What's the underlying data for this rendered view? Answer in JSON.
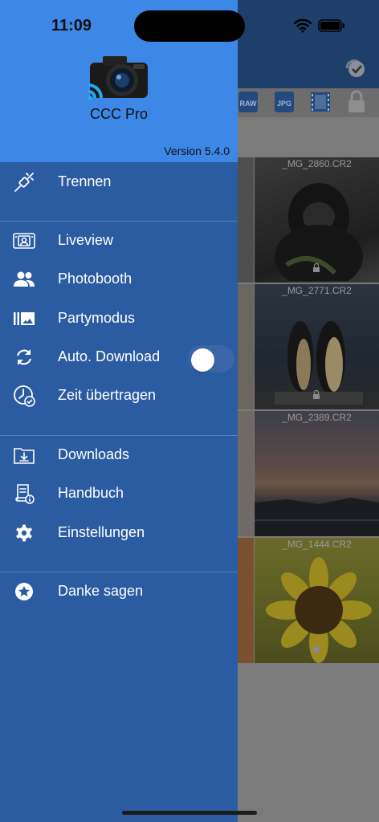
{
  "status_bar": {
    "time": "11:09"
  },
  "app": {
    "name": "CCC Pro",
    "version": "Version 5.4.0"
  },
  "menu": {
    "disconnect": {
      "label": "Trennen",
      "icon": "plug-icon"
    },
    "liveview": {
      "label": "Liveview",
      "icon": "camera-frame-icon"
    },
    "photobooth": {
      "label": "Photobooth",
      "icon": "people-icon"
    },
    "party": {
      "label": "Partymodus",
      "icon": "gallery-icon"
    },
    "auto_download": {
      "label": "Auto. Download",
      "icon": "sync-icon",
      "enabled": false
    },
    "time_transfer": {
      "label": "Zeit übertragen",
      "icon": "clock-check-icon"
    },
    "downloads": {
      "label": "Downloads",
      "icon": "download-folder-icon"
    },
    "manual": {
      "label": "Handbuch",
      "icon": "manual-icon"
    },
    "settings": {
      "label": "Einstellungen",
      "icon": "gear-icon"
    },
    "thanks": {
      "label": "Danke sagen",
      "icon": "star-badge-icon"
    }
  },
  "background": {
    "filters": [
      "RAW",
      "JPG",
      "video",
      "lock"
    ],
    "photos": [
      {
        "filename": "_MG_2860.CR2"
      },
      {
        "filename": "_MG_2771.CR2"
      },
      {
        "filename": "_MG_2389.CR2"
      },
      {
        "filename": "_MG_1444.CR2"
      }
    ]
  },
  "colors": {
    "drawer_bg": "#2b5ba1",
    "drawer_header_bg": "#3d87e6",
    "menu_text": "#ffffff"
  }
}
